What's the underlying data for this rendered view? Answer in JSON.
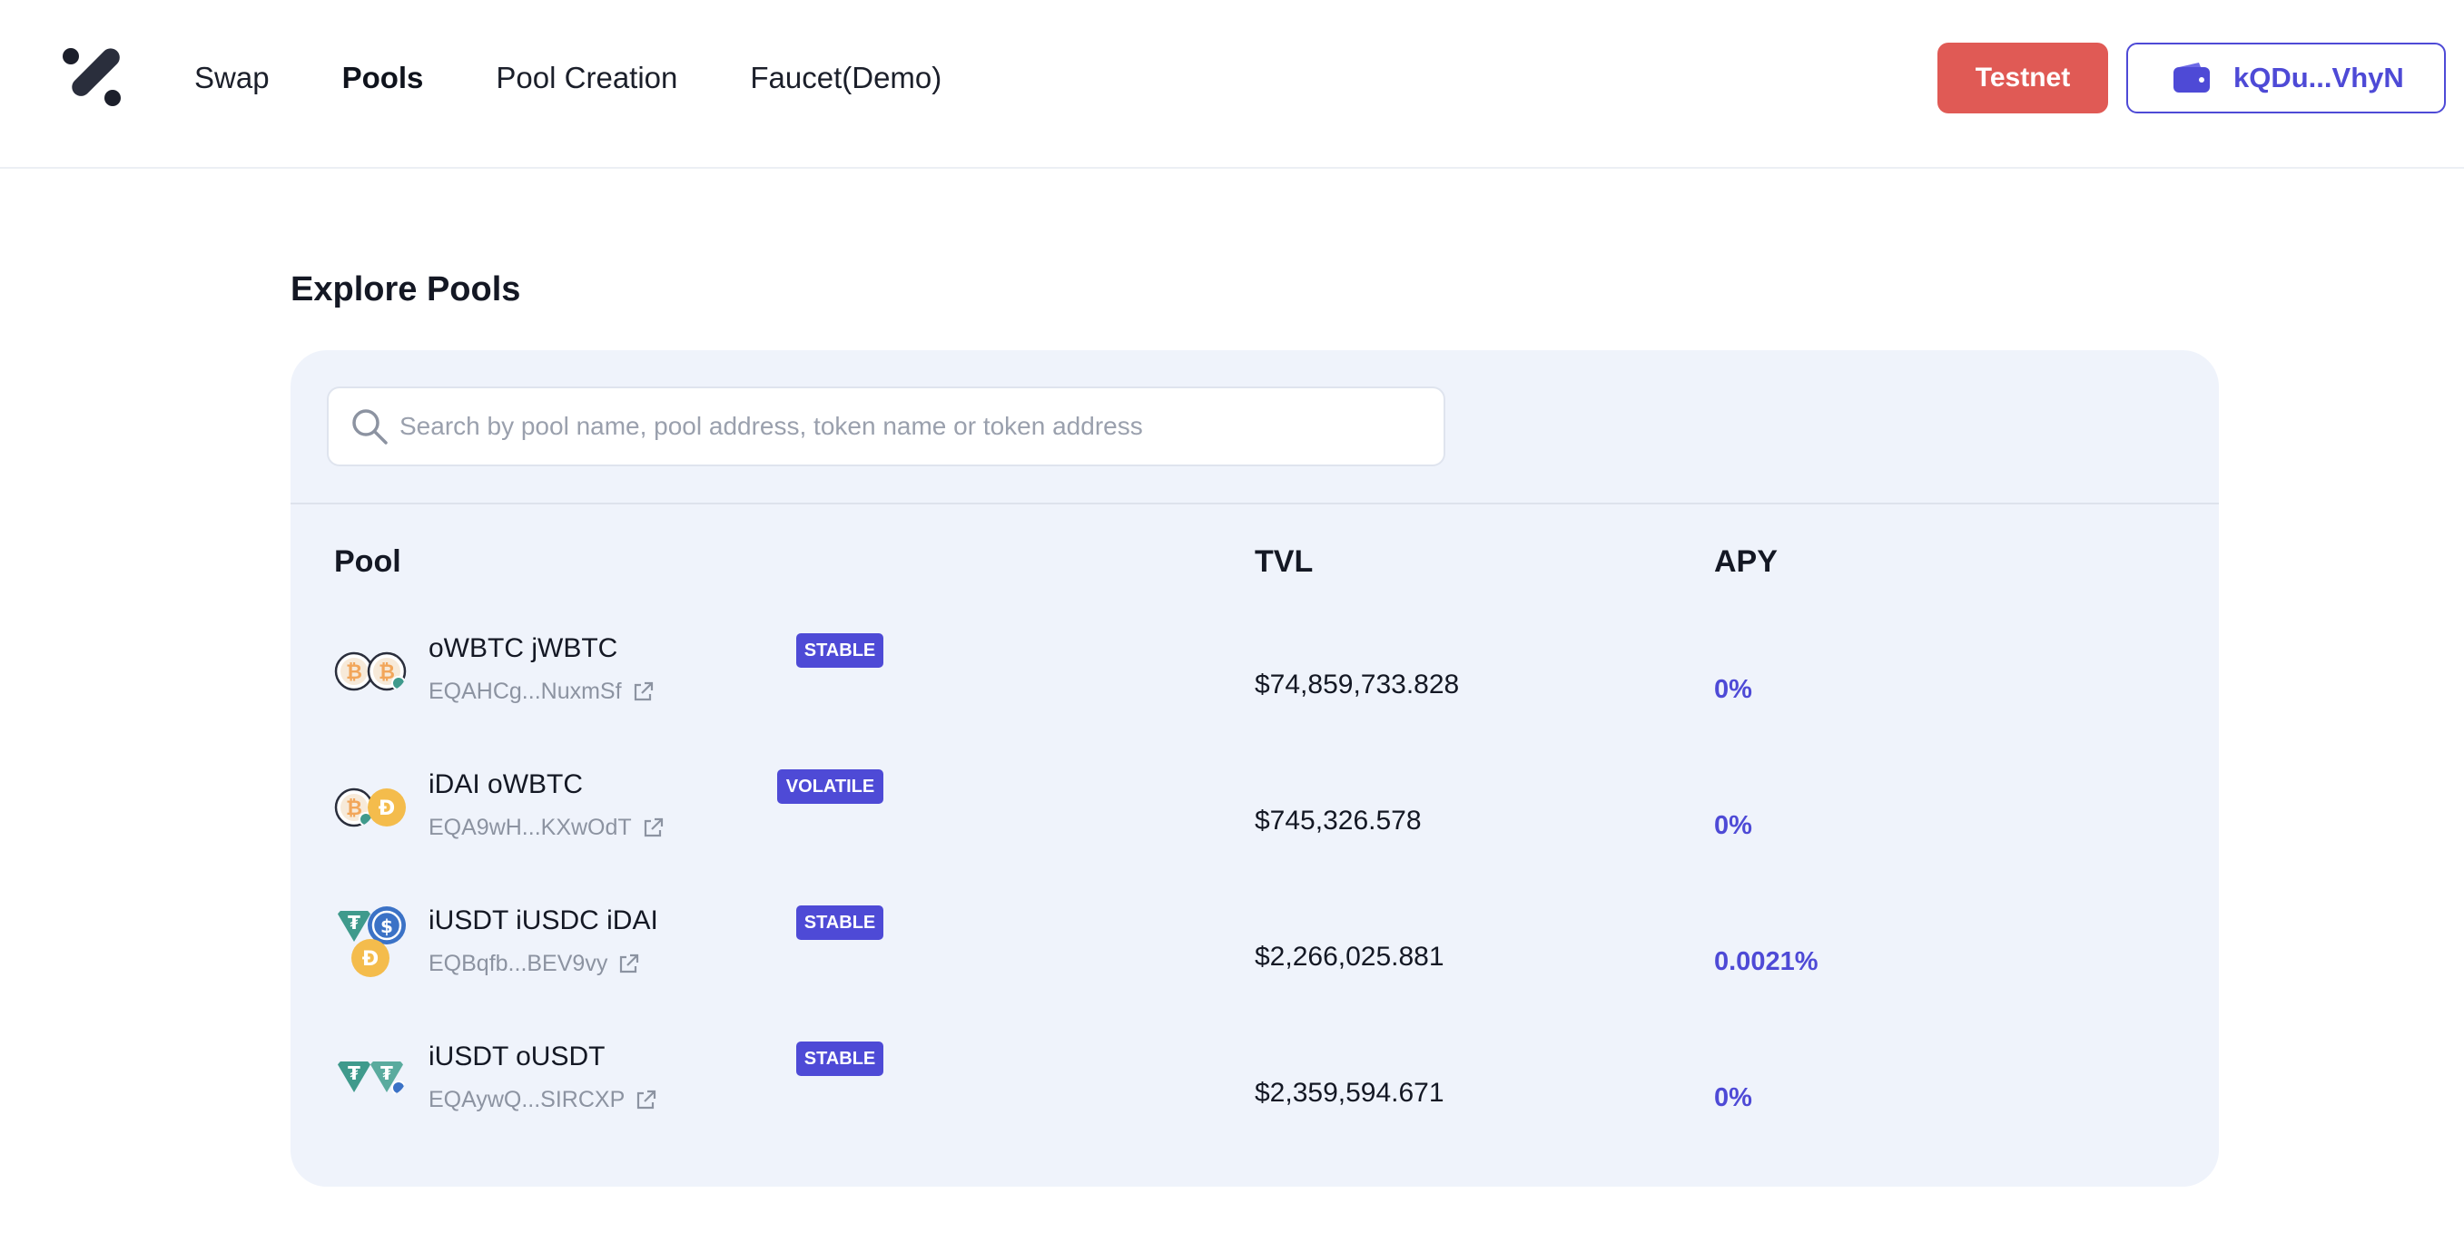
{
  "header": {
    "nav": [
      {
        "label": "Swap"
      },
      {
        "label": "Pools",
        "active": true
      },
      {
        "label": "Pool Creation"
      },
      {
        "label": "Faucet(Demo)"
      }
    ],
    "network_label": "Testnet",
    "wallet_label": "kQDu...VhyN"
  },
  "main": {
    "title": "Explore Pools",
    "search": {
      "placeholder": "Search by pool name, pool address, token name or token address",
      "value": ""
    },
    "columns": {
      "pool": "Pool",
      "tvl": "TVL",
      "apy": "APY"
    },
    "pools": [
      {
        "name": "oWBTC jWBTC",
        "address": "EQAHCg...NuxmSf",
        "type": "STABLE",
        "tvl": "$74,859,733.828",
        "apy": "0%",
        "icons": [
          "btc-coin-icon",
          "btc-bridged-coin-icon"
        ]
      },
      {
        "name": "iDAI oWBTC",
        "address": "EQA9wH...KXwOdT",
        "type": "VOLATILE",
        "tvl": "$745,326.578",
        "apy": "0%",
        "icons": [
          "btc-bridged-coin-icon",
          "dai-coin-icon"
        ]
      },
      {
        "name": "iUSDT iUSDC iDAI",
        "address": "EQBqfb...BEV9vy",
        "type": "STABLE",
        "tvl": "$2,266,025.881",
        "apy": "0.0021%",
        "icons": [
          "usdt-coin-icon",
          "usdc-coin-icon",
          "dai-coin-icon"
        ]
      },
      {
        "name": "iUSDT oUSDT",
        "address": "EQAywQ...SIRCXP",
        "type": "STABLE",
        "tvl": "$2,359,594.671",
        "apy": "0%",
        "icons": [
          "usdt-coin-icon",
          "usdt-bridged-coin-icon"
        ]
      }
    ]
  },
  "colors": {
    "accent": "#4e4ad6",
    "testnet": "#e05a55",
    "panel": "#eff3fb",
    "btc": "#f2a65a",
    "dai": "#f4bc4c",
    "usdt": "#3f9a8c",
    "usdc": "#3b72c6"
  }
}
